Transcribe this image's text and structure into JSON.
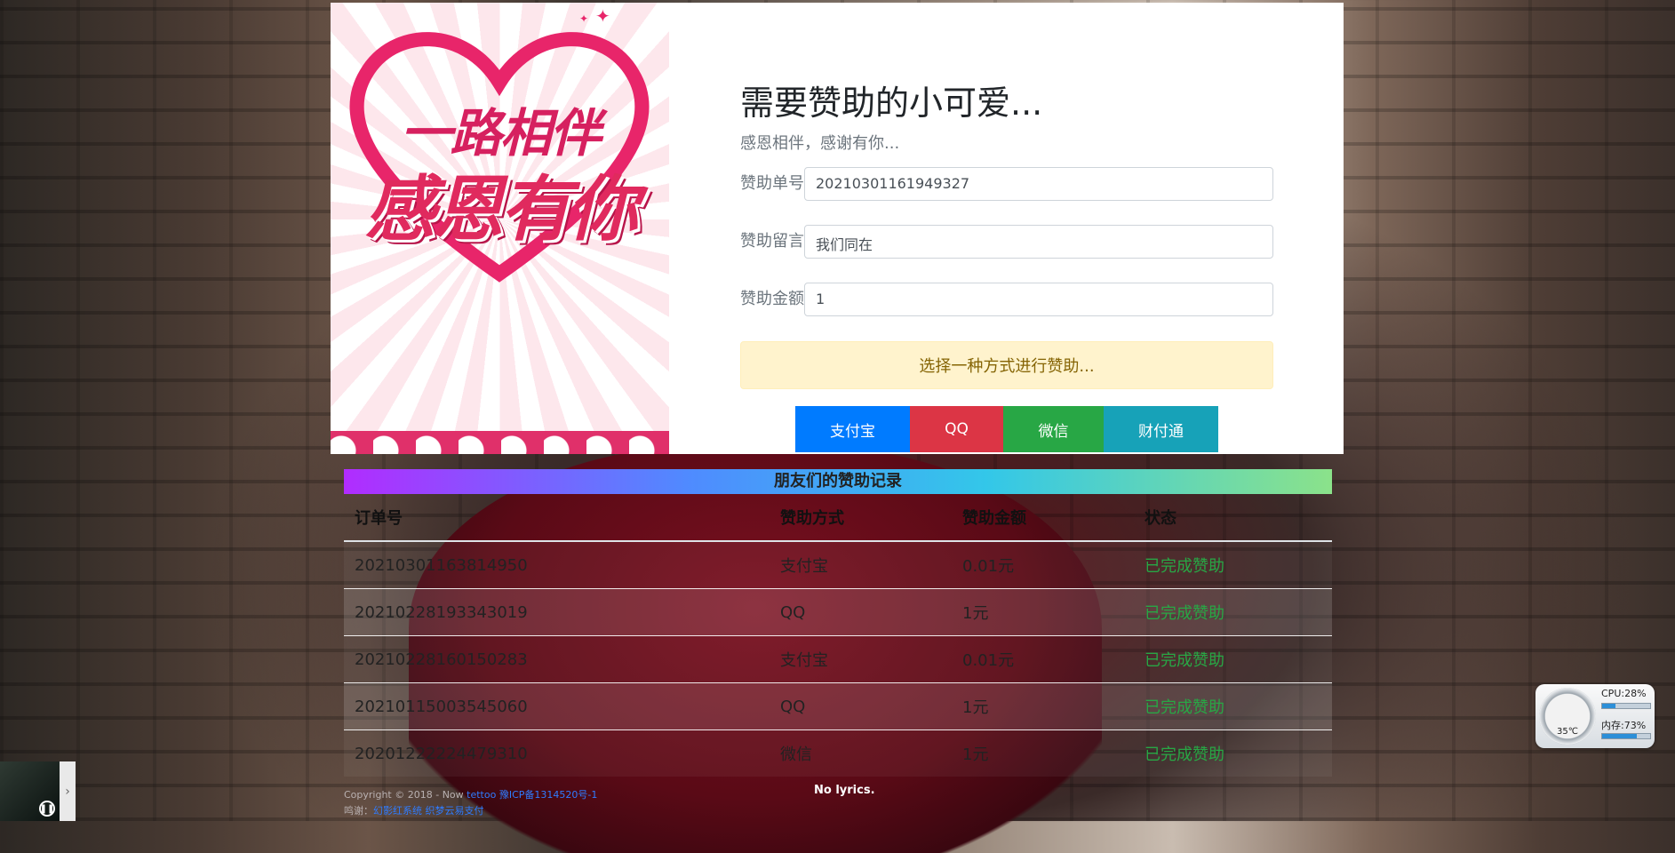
{
  "form": {
    "title": "需要赞助的小可爱...",
    "subtitle": "感恩相伴，感谢有你...",
    "fields": [
      {
        "label": "赞助单号",
        "value": "20210301161949327"
      },
      {
        "label": "赞助留言",
        "value": "我们同在"
      },
      {
        "label": "赞助金额",
        "value": "1"
      }
    ],
    "notice": "选择一种方式进行赞助...",
    "buttons": [
      {
        "label": "支付宝",
        "color": "#007bff"
      },
      {
        "label": "QQ",
        "color": "#dc3545"
      },
      {
        "label": "微信",
        "color": "#28a745"
      },
      {
        "label": "财付通",
        "color": "#17a2b8"
      }
    ]
  },
  "art": {
    "line1": "一路相伴",
    "line2": "感恩有你"
  },
  "records": {
    "title": "朋友们的赞助记录",
    "columns": [
      "订单号",
      "赞助方式",
      "赞助金额",
      "状态"
    ],
    "rows": [
      [
        "20210301163814950",
        "支付宝",
        "0.01元",
        "已完成赞助"
      ],
      [
        "20210228193343019",
        "QQ",
        "1元",
        "已完成赞助"
      ],
      [
        "20210228160150283",
        "支付宝",
        "0.01元",
        "已完成赞助"
      ],
      [
        "20210115003545060",
        "QQ",
        "1元",
        "已完成赞助"
      ],
      [
        "20201222224479310",
        "微信",
        "1元",
        "已完成赞助"
      ]
    ]
  },
  "footer": {
    "copyright": "Copyright © 2018 - Now ",
    "site": "tettoo",
    "icp": "豫ICP备1314520号-1",
    "thanks_prefix": "鸣谢：",
    "thanks_links": "幻影红系统 织梦云易支付"
  },
  "player": {
    "lyrics": "No lyrics."
  },
  "widget": {
    "cpu": "CPU:28%",
    "mem": "内存:73%",
    "temp": "35℃",
    "cpu_level": 0.28,
    "mem_level": 0.73
  }
}
